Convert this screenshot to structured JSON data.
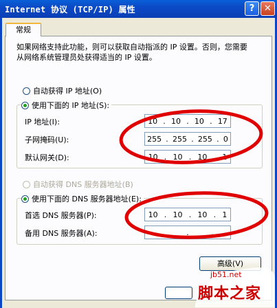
{
  "window": {
    "title": "Internet 协议 (TCP/IP) 属性",
    "help_btn": "?",
    "close_btn": "✕"
  },
  "tab": {
    "label": "常规"
  },
  "description": "如果网络支持此功能，则可以获取自动指派的 IP 设置。否则，您需要从网络系统管理员处获得适当的 IP 设置。",
  "ip": {
    "auto_radio": "自动获得 IP 地址(O)",
    "manual_radio": "使用下面的 IP 地址(S):",
    "selected": "manual",
    "rows": [
      {
        "label": "IP 地址(I):",
        "octets": [
          "10",
          "10",
          "10",
          "17"
        ]
      },
      {
        "label": "子网掩码(U):",
        "octets": [
          "255",
          "255",
          "255",
          "0"
        ]
      },
      {
        "label": "默认网关(D):",
        "octets": [
          "10",
          "10",
          "10",
          "1"
        ]
      }
    ]
  },
  "dns": {
    "auto_radio": "自动获得 DNS 服务器地址(B)",
    "manual_radio": "使用下面的 DNS 服务器地址(E):",
    "selected": "manual",
    "rows": [
      {
        "label": "首选 DNS 服务器(P):",
        "octets": [
          "10",
          "10",
          "10",
          "1"
        ]
      },
      {
        "label": "备用 DNS 服务器(A):",
        "octets": [
          "",
          "",
          "",
          ""
        ]
      }
    ]
  },
  "advanced_button": "高级(V)",
  "watermark": {
    "line1": "jb51.net",
    "line2": "脚本之家"
  },
  "colors": {
    "annotation": "#e00000",
    "titlebar": "#0a46c6"
  }
}
